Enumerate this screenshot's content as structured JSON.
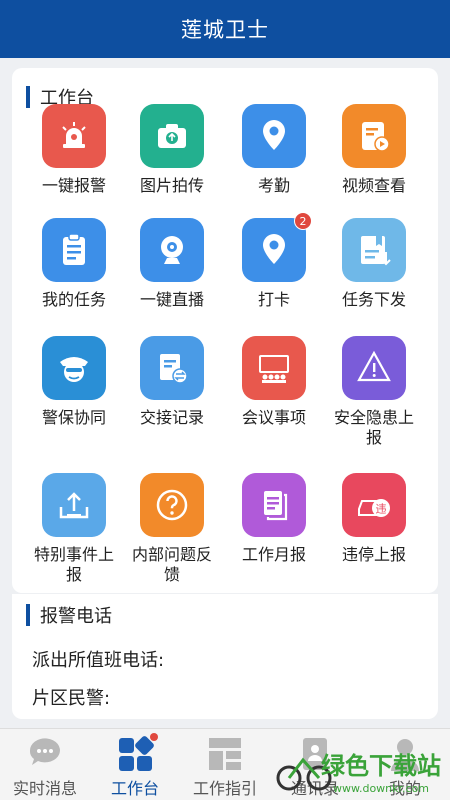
{
  "app": {
    "title": "莲城卫士"
  },
  "workbench": {
    "title": "工作台",
    "items": [
      {
        "label": "一键报警",
        "icon": "alarm-icon",
        "color": "#e8584d"
      },
      {
        "label": "图片拍传",
        "icon": "camera-upload-icon",
        "color": "#23b08f"
      },
      {
        "label": "考勤",
        "icon": "location-pin-icon",
        "color": "#3d8fe8"
      },
      {
        "label": "视频查看",
        "icon": "video-file-icon",
        "color": "#f28a2a"
      },
      {
        "label": "我的任务",
        "icon": "clipboard-icon",
        "color": "#3d8fe8"
      },
      {
        "label": "一键直播",
        "icon": "webcam-icon",
        "color": "#3d8fe8"
      },
      {
        "label": "打卡",
        "icon": "checkin-pin-icon",
        "color": "#3d8fe8",
        "badge": "2"
      },
      {
        "label": "任务下发",
        "icon": "task-dispatch-icon",
        "color": "#6fb8e8"
      },
      {
        "label": "警保协同",
        "icon": "police-officer-icon",
        "color": "#2a8fd6"
      },
      {
        "label": "交接记录",
        "icon": "handover-doc-icon",
        "color": "#4a9be6"
      },
      {
        "label": "会议事项",
        "icon": "meeting-icon",
        "color": "#e8584d"
      },
      {
        "label": "安全隐患上报",
        "icon": "warning-icon",
        "color": "#7a5cd9"
      },
      {
        "label": "特别事件上报",
        "icon": "upload-tray-icon",
        "color": "#5aa8e8"
      },
      {
        "label": "内部问题反馈",
        "icon": "question-icon",
        "color": "#f28a2a"
      },
      {
        "label": "工作月报",
        "icon": "report-doc-icon",
        "color": "#b05ad9"
      },
      {
        "label": "违停上报",
        "icon": "illegal-parking-icon",
        "color": "#e8485e"
      }
    ]
  },
  "phones": {
    "title": "报警电话",
    "rows": [
      "派出所值班电话:",
      "片区民警:"
    ]
  },
  "tabbar": {
    "tabs": [
      {
        "label": "实时消息",
        "icon": "chat-bubble-icon"
      },
      {
        "label": "工作台",
        "icon": "workbench-icon",
        "active": true
      },
      {
        "label": "工作指引",
        "icon": "guide-grid-icon"
      },
      {
        "label": "通讯录",
        "icon": "contacts-icon"
      },
      {
        "label": "我的",
        "icon": "profile-icon"
      }
    ]
  },
  "watermark": {
    "text": "绿色下载站",
    "url": "www.downkr.com"
  }
}
